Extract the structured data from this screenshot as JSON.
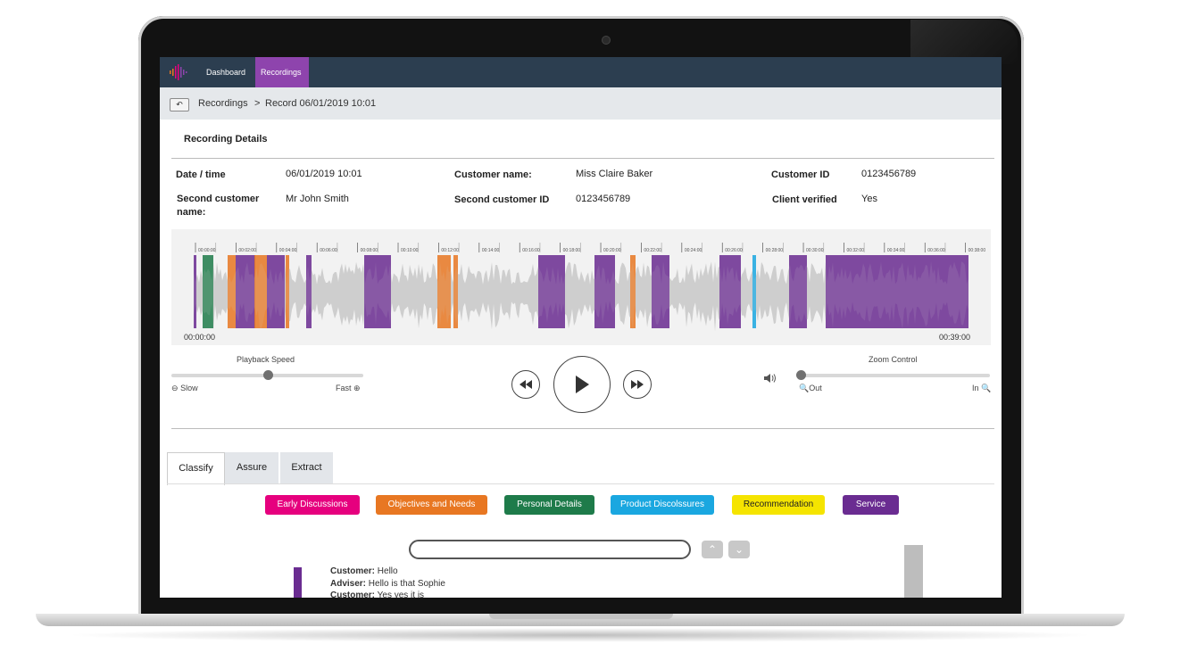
{
  "nav": {
    "items": [
      "Dashboard",
      "Recordings"
    ]
  },
  "breadcrumb": {
    "parent": "Recordings",
    "separator": ">",
    "current": "Record 06/01/2019 10:01"
  },
  "details": {
    "title": "Recording Details",
    "date_time": {
      "label": "Date / time",
      "value": "06/01/2019 10:01"
    },
    "customer_name": {
      "label": "Customer name:",
      "value": "Miss Claire Baker"
    },
    "customer_id": {
      "label": "Customer ID",
      "value": "0123456789"
    },
    "second_customer_name": {
      "label": "Second customer name:",
      "value": "Mr John Smith"
    },
    "second_customer_id": {
      "label": "Second customer ID",
      "value": "0123456789"
    },
    "client_verified": {
      "label": "Client verified",
      "value": "Yes"
    }
  },
  "waveform": {
    "start_time": "00:00:00",
    "end_time": "00:39:00",
    "ticks": [
      "00:00:00",
      "00:01:00",
      "00:02:00",
      "00:03:00",
      "00:04:00",
      "00:05:00",
      "00:06:00",
      "00:07:00",
      "00:08:00",
      "00:09:00",
      "00:10:00",
      "00:11:00",
      "00:12:00",
      "00:13:00",
      "00:14:00",
      "00:15:00",
      "00:16:00",
      "00:17:00",
      "00:18:00",
      "00:19:00",
      "00:20:00",
      "00:21:00",
      "00:22:00",
      "00:23:00",
      "00:24:00",
      "00:25:00",
      "00:26:00",
      "00:27:00",
      "00:28:00",
      "00:29:00",
      "00:30:00",
      "00:31:00",
      "00:32:00",
      "00:33:00",
      "00:34:00",
      "00:35:00",
      "00:36:00",
      "00:37:00",
      "00:38:00"
    ]
  },
  "playback": {
    "label": "Playback Speed",
    "min_label": "Slow",
    "max_label": "Fast",
    "value_fraction": 0.5
  },
  "zoom": {
    "label": "Zoom Control",
    "min_label": "Out",
    "max_label": "In",
    "value_fraction": 0.0
  },
  "tabs": [
    "Classify",
    "Assure",
    "Extract"
  ],
  "categories": [
    {
      "label": "Early Discussions",
      "color": "#e6007e"
    },
    {
      "label": "Objectives and Needs",
      "color": "#e87722"
    },
    {
      "label": "Personal Details",
      "color": "#1e7b4a"
    },
    {
      "label": "Product Discolssures",
      "color": "#1aa7e0"
    },
    {
      "label": "Recommendation",
      "color": "#f5e400"
    },
    {
      "label": "Service",
      "color": "#6a2c91"
    }
  ],
  "transcript": [
    {
      "speaker": "Customer:",
      "text": "Hello"
    },
    {
      "speaker": "Adviser:",
      "text": "Hello is that Sophie"
    },
    {
      "speaker": "Customer:",
      "text": "Yes yes it is"
    }
  ]
}
